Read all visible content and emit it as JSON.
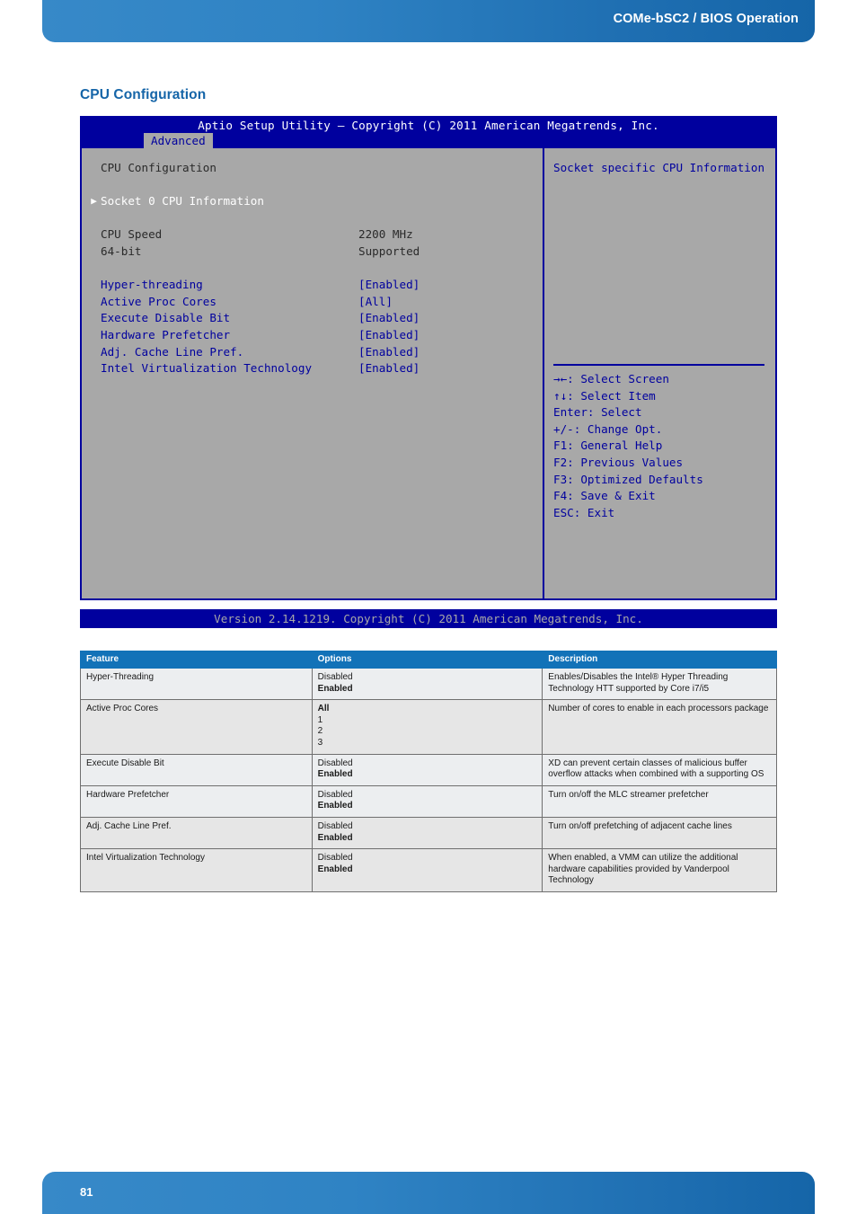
{
  "header": {
    "title": "COMe-bSC2 / BIOS Operation"
  },
  "section": {
    "heading": "CPU Configuration"
  },
  "bios": {
    "app_title": "Aptio Setup Utility – Copyright (C) 2011 American Megatrends, Inc.",
    "active_tab": "Advanced",
    "screen_title": "CPU Configuration",
    "submenu": {
      "arrow_glyph": "▶",
      "label": "Socket 0 CPU Information"
    },
    "info_rows": [
      {
        "label": "CPU Speed",
        "value": "2200 MHz"
      },
      {
        "label": "64-bit",
        "value": "Supported"
      }
    ],
    "setting_rows": [
      {
        "label": "Hyper-threading",
        "value": "[Enabled]"
      },
      {
        "label": "Active Proc Cores",
        "value": "[All]"
      },
      {
        "label": "Execute Disable Bit",
        "value": "[Enabled]"
      },
      {
        "label": "Hardware Prefetcher",
        "value": "[Enabled]"
      },
      {
        "label": "Adj. Cache Line Pref.",
        "value": "[Enabled]"
      },
      {
        "label": "Intel Virtualization Technology",
        "value": "[Enabled]"
      }
    ],
    "help_title": "Socket specific CPU Information",
    "keys": [
      "→←: Select Screen",
      "↑↓: Select Item",
      "Enter: Select",
      "+/-: Change Opt.",
      "F1: General Help",
      "F2: Previous Values",
      "F3: Optimized Defaults",
      "F4: Save & Exit",
      "ESC: Exit"
    ],
    "version": "Version 2.14.1219. Copyright (C) 2011 American Megatrends, Inc."
  },
  "table": {
    "columns": [
      "Feature",
      "Options",
      "Description"
    ],
    "rows": [
      {
        "feature": "Hyper-Threading",
        "options": [
          {
            "text": "Disabled",
            "bold": false
          },
          {
            "text": "Enabled",
            "bold": true
          }
        ],
        "description": "Enables/Disables the Intel® Hyper Threading Technology HTT supported by Core i7/i5"
      },
      {
        "feature": "Active Proc Cores",
        "options": [
          {
            "text": "All",
            "bold": true
          },
          {
            "text": "1",
            "bold": false
          },
          {
            "text": "2",
            "bold": false
          },
          {
            "text": "3",
            "bold": false
          }
        ],
        "description": "Number of cores to enable in each processors package"
      },
      {
        "feature": "Execute Disable Bit",
        "options": [
          {
            "text": "Disabled",
            "bold": false
          },
          {
            "text": "Enabled",
            "bold": true
          }
        ],
        "description": "XD can prevent certain classes of malicious buffer overflow attacks when combined with a supporting OS"
      },
      {
        "feature": "Hardware Prefetcher",
        "options": [
          {
            "text": "Disabled",
            "bold": false
          },
          {
            "text": "Enabled",
            "bold": true
          }
        ],
        "description": "Turn on/off the MLC streamer prefetcher"
      },
      {
        "feature": "Adj. Cache Line Pref.",
        "options": [
          {
            "text": "Disabled",
            "bold": false
          },
          {
            "text": "Enabled",
            "bold": true
          }
        ],
        "description": "Turn on/off prefetching of adjacent cache lines"
      },
      {
        "feature": "Intel Virtualization Technology",
        "options": [
          {
            "text": "Disabled",
            "bold": false
          },
          {
            "text": "Enabled",
            "bold": true
          }
        ],
        "description": "When enabled, a VMM can utilize the additional hardware capabilities provided by Vanderpool Technology"
      }
    ]
  },
  "footer": {
    "page_number": "81"
  },
  "colors": {
    "brand_blue": "#1565a8",
    "table_header_blue": "#1272b8",
    "bios_blue": "#00009e",
    "bios_gray": "#a8a8a8"
  }
}
